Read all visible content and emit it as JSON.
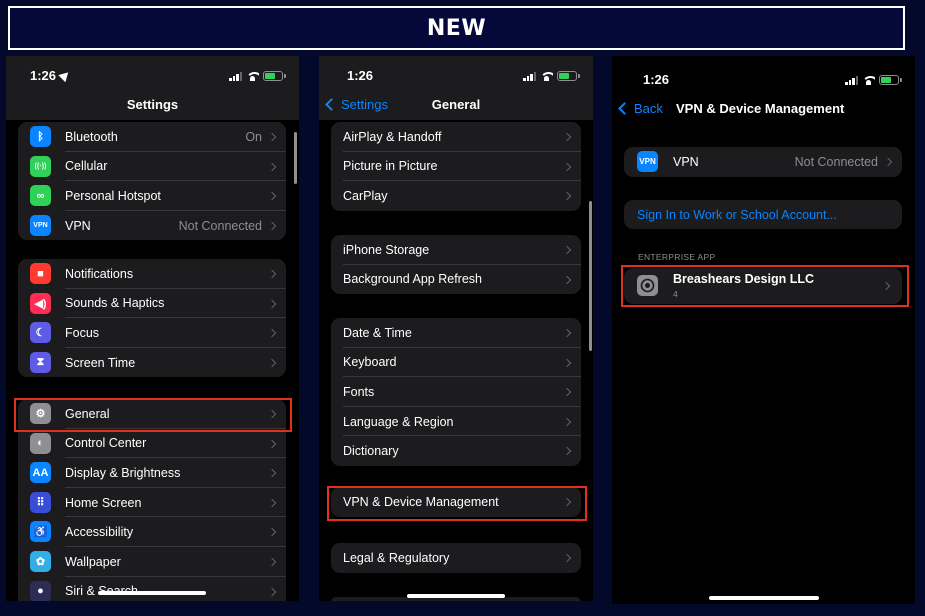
{
  "banner": {
    "title": "NEW"
  },
  "screen1": {
    "time": "1:26",
    "title": "Settings",
    "groups": [
      [
        {
          "label": "Bluetooth",
          "value": "On",
          "icon": "bluetooth-icon",
          "color": "#0a84ff",
          "glyph": "ᛒ"
        },
        {
          "label": "Cellular",
          "value": "",
          "icon": "cellular-icon",
          "color": "#30d158",
          "glyph": "((·))"
        },
        {
          "label": "Personal Hotspot",
          "value": "",
          "icon": "hotspot-icon",
          "color": "#30d158",
          "glyph": "∞"
        },
        {
          "label": "VPN",
          "value": "Not Connected",
          "icon": "vpn-icon",
          "color": "#0a84ff",
          "glyph": "VPN"
        }
      ],
      [
        {
          "label": "Notifications",
          "value": "",
          "icon": "notifications-icon",
          "color": "#ff3b30",
          "glyph": "■"
        },
        {
          "label": "Sounds & Haptics",
          "value": "",
          "icon": "sounds-icon",
          "color": "#ff2d55",
          "glyph": "◀)"
        },
        {
          "label": "Focus",
          "value": "",
          "icon": "focus-moon-icon",
          "color": "#5e5ce6",
          "glyph": "☾"
        },
        {
          "label": "Screen Time",
          "value": "",
          "icon": "screen-time-icon",
          "color": "#5e5ce6",
          "glyph": "⧗"
        }
      ],
      [
        {
          "label": "General",
          "value": "",
          "icon": "gear-icon",
          "color": "#8e8e93",
          "glyph": "⚙"
        },
        {
          "label": "Control Center",
          "value": "",
          "icon": "control-center-icon",
          "color": "#8e8e93",
          "glyph": "◐"
        },
        {
          "label": "Display & Brightness",
          "value": "",
          "icon": "display-icon",
          "color": "#0a84ff",
          "glyph": "AA"
        },
        {
          "label": "Home Screen",
          "value": "",
          "icon": "home-screen-icon",
          "color": "#3a4dd6",
          "glyph": "⠿"
        },
        {
          "label": "Accessibility",
          "value": "",
          "icon": "accessibility-icon",
          "color": "#0a84ff",
          "glyph": "♿"
        },
        {
          "label": "Wallpaper",
          "value": "",
          "icon": "wallpaper-icon",
          "color": "#32ade6",
          "glyph": "✿"
        },
        {
          "label": "Siri & Search",
          "value": "",
          "icon": "siri-icon",
          "color": "#2c2c54",
          "glyph": "●"
        }
      ]
    ]
  },
  "screen2": {
    "time": "1:26",
    "back_label": "Settings",
    "title": "General",
    "groups": [
      [
        "AirPlay & Handoff",
        "Picture in Picture",
        "CarPlay"
      ],
      [
        "iPhone Storage",
        "Background App Refresh"
      ],
      [
        "Date & Time",
        "Keyboard",
        "Fonts",
        "Language & Region",
        "Dictionary"
      ],
      [
        "VPN & Device Management"
      ],
      [
        "Legal & Regulatory"
      ]
    ]
  },
  "screen3": {
    "time": "1:26",
    "back_label": "Back",
    "title": "VPN & Device Management",
    "vpn_row": {
      "icon_text": "VPN",
      "label": "VPN",
      "value": "Not Connected"
    },
    "sign_in_label": "Sign In to Work or School Account...",
    "section_header": "ENTERPRISE APP",
    "app_row": {
      "name": "Breashears Design LLC",
      "count": "4"
    }
  },
  "colors": {
    "accent": "#0a84ff",
    "highlight": "#e0301e",
    "background": "#03092a"
  }
}
